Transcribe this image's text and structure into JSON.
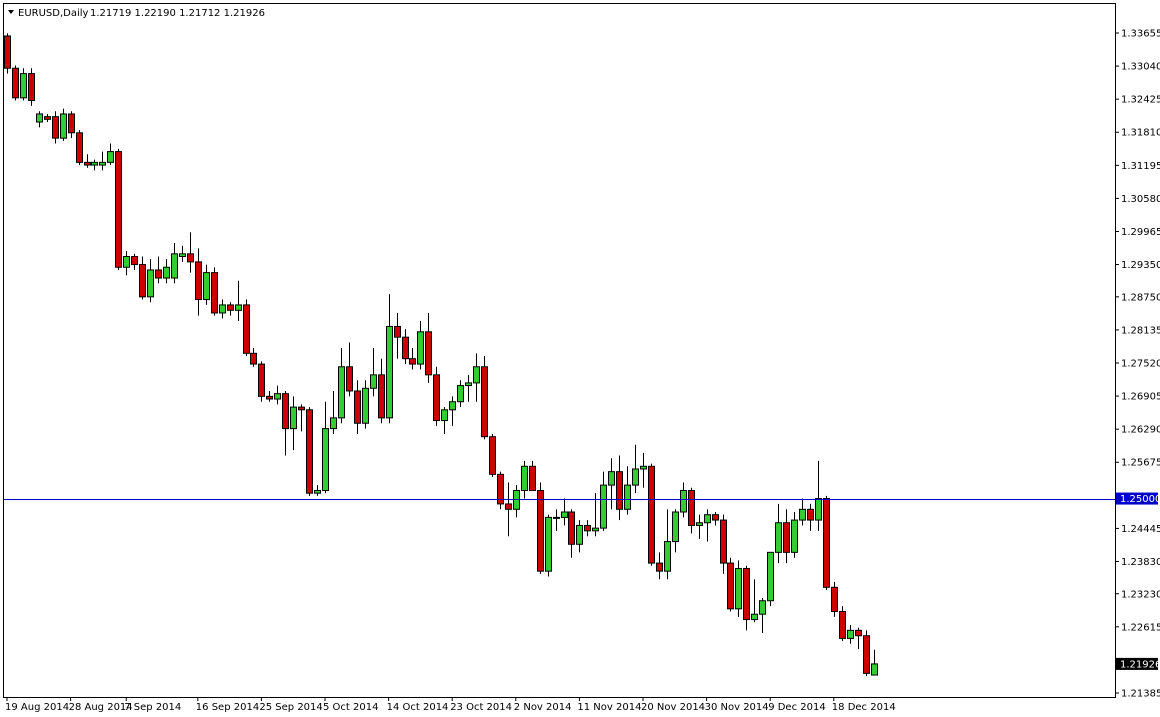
{
  "header": {
    "symbol": "EURUSD,Daily",
    "ohlc": "1.21719 1.22190 1.21712 1.21926"
  },
  "colors": {
    "background": "#ffffff",
    "frame": "#000000",
    "bull": "#32cd32",
    "bear": "#cc0000",
    "wick": "#000000",
    "horizontal_line": "#0000cc",
    "price_tag_hline": "#0000cc",
    "price_tag_current": "#000000"
  },
  "chart_data": {
    "type": "candlestick",
    "title": "EURUSD,Daily",
    "ylim": [
      1.2134,
      1.339
    ],
    "y_ticks": [
      "1.33655",
      "1.33040",
      "1.32425",
      "1.31810",
      "1.31195",
      "1.30580",
      "1.29965",
      "1.29350",
      "1.28750",
      "1.28135",
      "1.27520",
      "1.26905",
      "1.26290",
      "1.25675",
      "1.24445",
      "1.23830",
      "1.23230",
      "1.22615",
      "1.21385"
    ],
    "x_ticks": [
      {
        "label": "19 Aug 2014",
        "index": 0
      },
      {
        "label": "28 Aug 2014",
        "index": 8
      },
      {
        "label": "7 Sep 2014",
        "index": 15
      },
      {
        "label": "16 Sep 2014",
        "index": 24
      },
      {
        "label": "25 Sep 2014",
        "index": 32
      },
      {
        "label": "5 Oct 2014",
        "index": 40
      },
      {
        "label": "14 Oct 2014",
        "index": 48
      },
      {
        "label": "23 Oct 2014",
        "index": 56
      },
      {
        "label": "2 Nov 2014",
        "index": 64
      },
      {
        "label": "11 Nov 2014",
        "index": 72
      },
      {
        "label": "20 Nov 2014",
        "index": 80
      },
      {
        "label": "30 Nov 2014",
        "index": 88
      },
      {
        "label": "9 Dec 2014",
        "index": 96
      },
      {
        "label": "18 Dec 2014",
        "index": 104
      }
    ],
    "horizontal_line": {
      "value": 1.25,
      "label": "1.25000"
    },
    "current_price": {
      "value": 1.21926,
      "label": "1.21926"
    },
    "candles": [
      [
        1.336,
        1.3365,
        1.329,
        1.33
      ],
      [
        1.33,
        1.3305,
        1.324,
        1.3245
      ],
      [
        1.3245,
        1.33,
        1.324,
        1.329
      ],
      [
        1.329,
        1.33,
        1.323,
        1.324
      ],
      [
        1.32,
        1.322,
        1.319,
        1.3215
      ],
      [
        1.321,
        1.3215,
        1.32,
        1.3205
      ],
      [
        1.321,
        1.322,
        1.316,
        1.317
      ],
      [
        1.317,
        1.3225,
        1.3165,
        1.3215
      ],
      [
        1.3215,
        1.322,
        1.317,
        1.318
      ],
      [
        1.318,
        1.3185,
        1.312,
        1.3125
      ],
      [
        1.3125,
        1.314,
        1.3115,
        1.312
      ],
      [
        1.312,
        1.313,
        1.311,
        1.3125
      ],
      [
        1.312,
        1.3145,
        1.311,
        1.3125
      ],
      [
        1.3125,
        1.316,
        1.312,
        1.3145
      ],
      [
        1.3145,
        1.315,
        1.2925,
        1.293
      ],
      [
        1.293,
        1.296,
        1.2915,
        1.295
      ],
      [
        1.295,
        1.2955,
        1.2925,
        1.2935
      ],
      [
        1.2935,
        1.295,
        1.287,
        1.2875
      ],
      [
        1.2875,
        1.2945,
        1.2865,
        1.2925
      ],
      [
        1.2925,
        1.295,
        1.29,
        1.291
      ],
      [
        1.291,
        1.2945,
        1.29,
        1.293
      ],
      [
        1.291,
        1.2975,
        1.29,
        1.2955
      ],
      [
        1.295,
        1.297,
        1.294,
        1.2955
      ],
      [
        1.2955,
        1.2995,
        1.292,
        1.294
      ],
      [
        1.294,
        1.2965,
        1.284,
        1.287
      ],
      [
        1.287,
        1.2935,
        1.286,
        1.292
      ],
      [
        1.292,
        1.293,
        1.284,
        1.2845
      ],
      [
        1.2845,
        1.287,
        1.2835,
        1.286
      ],
      [
        1.286,
        1.2865,
        1.284,
        1.285
      ],
      [
        1.285,
        1.2905,
        1.283,
        1.286
      ],
      [
        1.286,
        1.287,
        1.2765,
        1.277
      ],
      [
        1.277,
        1.278,
        1.2745,
        1.275
      ],
      [
        1.275,
        1.2755,
        1.268,
        1.269
      ],
      [
        1.269,
        1.27,
        1.268,
        1.2685
      ],
      [
        1.2685,
        1.271,
        1.2675,
        1.2695
      ],
      [
        1.2695,
        1.27,
        1.258,
        1.263
      ],
      [
        1.263,
        1.269,
        1.259,
        1.267
      ],
      [
        1.267,
        1.2675,
        1.2625,
        1.2665
      ],
      [
        1.2665,
        1.267,
        1.2505,
        1.251
      ],
      [
        1.251,
        1.2525,
        1.2505,
        1.2515
      ],
      [
        1.2515,
        1.268,
        1.251,
        1.263
      ],
      [
        1.263,
        1.27,
        1.262,
        1.265
      ],
      [
        1.265,
        1.278,
        1.264,
        1.2745
      ],
      [
        1.2745,
        1.279,
        1.269,
        1.27
      ],
      [
        1.27,
        1.272,
        1.262,
        1.264
      ],
      [
        1.264,
        1.272,
        1.263,
        1.2705
      ],
      [
        1.2705,
        1.278,
        1.269,
        1.273
      ],
      [
        1.273,
        1.276,
        1.264,
        1.265
      ],
      [
        1.265,
        1.288,
        1.264,
        1.282
      ],
      [
        1.282,
        1.2845,
        1.276,
        1.28
      ],
      [
        1.28,
        1.2815,
        1.275,
        1.276
      ],
      [
        1.276,
        1.278,
        1.274,
        1.275
      ],
      [
        1.275,
        1.283,
        1.274,
        1.281
      ],
      [
        1.281,
        1.2845,
        1.2715,
        1.273
      ],
      [
        1.273,
        1.2745,
        1.2635,
        1.2645
      ],
      [
        1.2645,
        1.267,
        1.262,
        1.2665
      ],
      [
        1.2665,
        1.269,
        1.2635,
        1.268
      ],
      [
        1.268,
        1.272,
        1.267,
        1.271
      ],
      [
        1.271,
        1.273,
        1.268,
        1.2715
      ],
      [
        1.2715,
        1.277,
        1.268,
        1.2745
      ],
      [
        1.2745,
        1.2765,
        1.261,
        1.2615
      ],
      [
        1.2615,
        1.262,
        1.254,
        1.2545
      ],
      [
        1.2545,
        1.255,
        1.248,
        1.249
      ],
      [
        1.249,
        1.253,
        1.243,
        1.248
      ],
      [
        1.248,
        1.2525,
        1.2465,
        1.2515
      ],
      [
        1.2515,
        1.257,
        1.25,
        1.256
      ],
      [
        1.256,
        1.257,
        1.2515,
        1.2515
      ],
      [
        1.2515,
        1.253,
        1.236,
        1.2365
      ],
      [
        1.2365,
        1.247,
        1.2355,
        1.2465
      ],
      [
        1.2465,
        1.248,
        1.244,
        1.2465
      ],
      [
        1.2465,
        1.25,
        1.245,
        1.2475
      ],
      [
        1.2475,
        1.248,
        1.239,
        1.2415
      ],
      [
        1.2415,
        1.246,
        1.24,
        1.245
      ],
      [
        1.245,
        1.246,
        1.243,
        1.244
      ],
      [
        1.244,
        1.251,
        1.243,
        1.2445
      ],
      [
        1.2445,
        1.255,
        1.244,
        1.2525
      ],
      [
        1.2525,
        1.2575,
        1.248,
        1.255
      ],
      [
        1.255,
        1.258,
        1.246,
        1.248
      ],
      [
        1.248,
        1.256,
        1.247,
        1.2525
      ],
      [
        1.2525,
        1.26,
        1.251,
        1.2555
      ],
      [
        1.2555,
        1.2585,
        1.252,
        1.256
      ],
      [
        1.256,
        1.2565,
        1.2375,
        1.238
      ],
      [
        1.238,
        1.24,
        1.235,
        1.2365
      ],
      [
        1.2365,
        1.248,
        1.235,
        1.242
      ],
      [
        1.242,
        1.248,
        1.24,
        1.2475
      ],
      [
        1.2475,
        1.253,
        1.2465,
        1.2515
      ],
      [
        1.2515,
        1.252,
        1.2435,
        1.245
      ],
      [
        1.245,
        1.247,
        1.2425,
        1.2455
      ],
      [
        1.2455,
        1.248,
        1.242,
        1.247
      ],
      [
        1.247,
        1.2475,
        1.245,
        1.246
      ],
      [
        1.246,
        1.247,
        1.236,
        1.238
      ],
      [
        1.238,
        1.239,
        1.229,
        1.2295
      ],
      [
        1.2295,
        1.2385,
        1.228,
        1.237
      ],
      [
        1.237,
        1.2375,
        1.2255,
        1.2275
      ],
      [
        1.2275,
        1.235,
        1.227,
        1.2285
      ],
      [
        1.2285,
        1.2315,
        1.225,
        1.231
      ],
      [
        1.231,
        1.24,
        1.23,
        1.24
      ],
      [
        1.24,
        1.249,
        1.238,
        1.2455
      ],
      [
        1.2455,
        1.248,
        1.238,
        1.24
      ],
      [
        1.24,
        1.2475,
        1.239,
        1.246
      ],
      [
        1.246,
        1.25,
        1.245,
        1.248
      ],
      [
        1.248,
        1.249,
        1.244,
        1.246
      ],
      [
        1.246,
        1.257,
        1.244,
        1.25
      ],
      [
        1.25,
        1.2505,
        1.233,
        1.2335
      ],
      [
        1.2335,
        1.2345,
        1.228,
        1.229
      ],
      [
        1.229,
        1.23,
        1.2235,
        1.224
      ],
      [
        1.224,
        1.2265,
        1.223,
        1.2255
      ],
      [
        1.2255,
        1.226,
        1.222,
        1.2245
      ],
      [
        1.2245,
        1.2255,
        1.217,
        1.2175
      ],
      [
        1.21719,
        1.2219,
        1.21712,
        1.21926
      ]
    ]
  }
}
